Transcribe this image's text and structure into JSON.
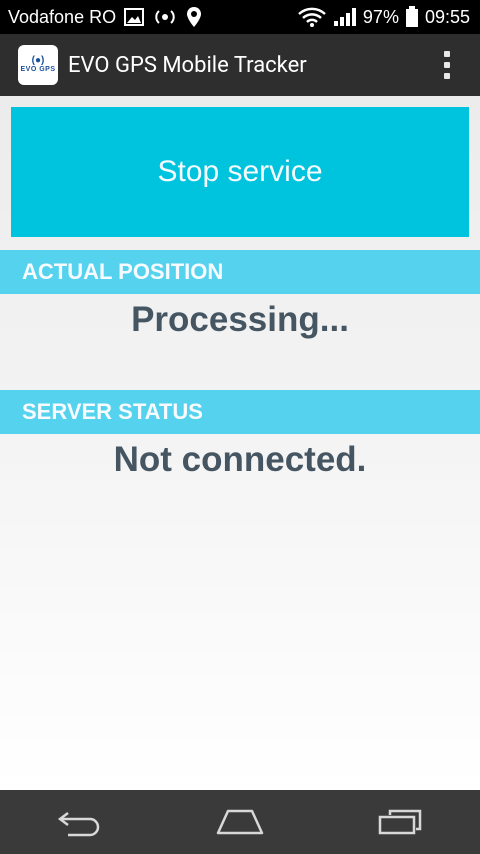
{
  "status_bar": {
    "carrier": "Vodafone RO",
    "battery": "97%",
    "time": "09:55",
    "icons": [
      "image-icon",
      "broadcast-icon",
      "location-pin-icon",
      "wifi-icon",
      "signal-icon",
      "battery-icon"
    ]
  },
  "app_bar": {
    "logo_text": "EVO GPS",
    "title": "EVO GPS Mobile Tracker",
    "menu_icon": "overflow-menu-icon"
  },
  "main": {
    "stop_button_label": "Stop service",
    "sections": [
      {
        "header": "ACTUAL POSITION",
        "value": "Processing..."
      },
      {
        "header": "SERVER STATUS",
        "value": "Not connected."
      }
    ]
  },
  "nav_bar": {
    "icons": [
      "back-icon",
      "home-icon",
      "recent-apps-icon"
    ]
  },
  "colors": {
    "accent": "#00c4dd",
    "section_header": "#55d3ee",
    "value_text": "#455562",
    "app_bar": "#2e2e2e"
  }
}
